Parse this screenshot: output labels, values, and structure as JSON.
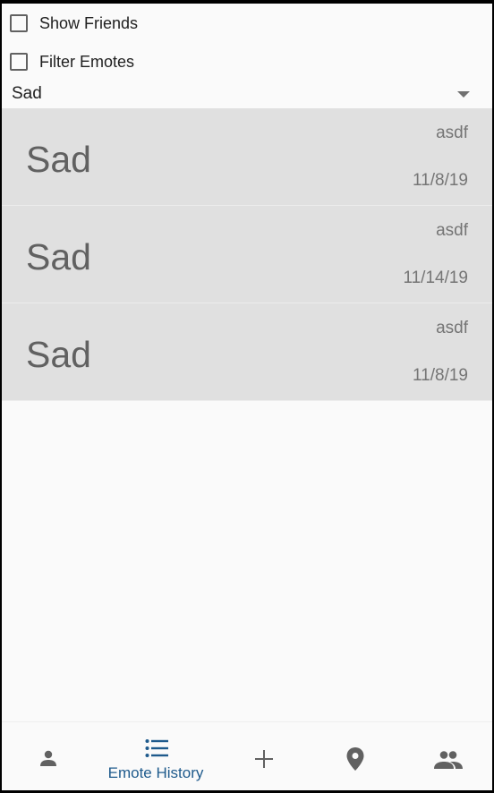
{
  "filters": {
    "show_friends": {
      "label": "Show Friends",
      "checked": false
    },
    "filter_emotes": {
      "label": "Filter Emotes",
      "checked": false
    }
  },
  "dropdown": {
    "selected": "Sad"
  },
  "emote_history": [
    {
      "emote": "Sad",
      "user": "asdf",
      "date": "11/8/19"
    },
    {
      "emote": "Sad",
      "user": "asdf",
      "date": "11/14/19"
    },
    {
      "emote": "Sad",
      "user": "asdf",
      "date": "11/8/19"
    }
  ],
  "bottom_nav": {
    "active_label": "Emote History",
    "items": [
      {
        "icon": "person-icon"
      },
      {
        "icon": "list-icon"
      },
      {
        "icon": "plus-icon"
      },
      {
        "icon": "location-pin-icon"
      },
      {
        "icon": "people-icon"
      }
    ]
  },
  "colors": {
    "card_background": "#e0e0e0",
    "accent": "#1e5a8c",
    "icon_gray": "#616161"
  }
}
